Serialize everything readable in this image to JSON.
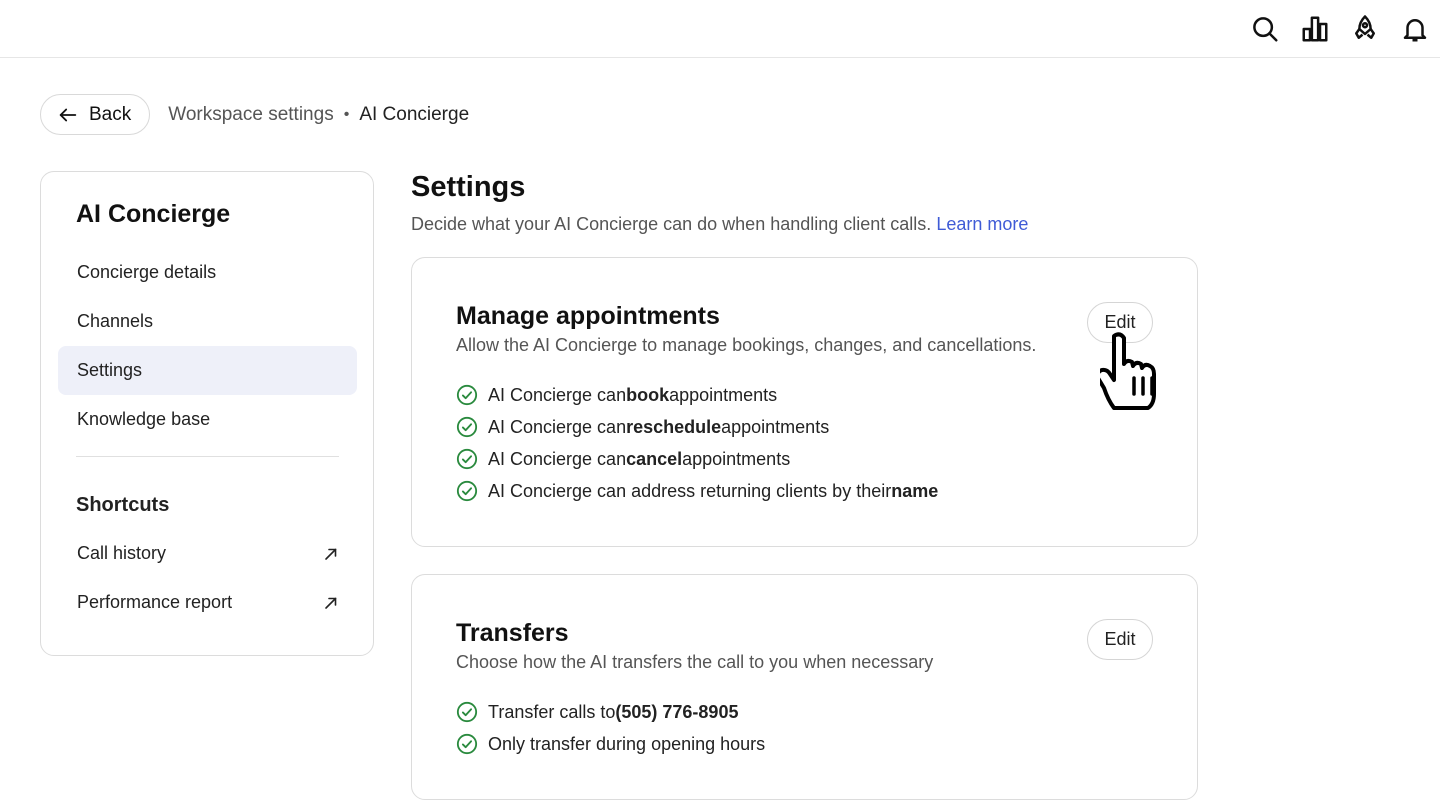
{
  "topbar": {
    "icons": [
      "search-icon",
      "bar-chart-icon",
      "rocket-icon",
      "bell-icon"
    ]
  },
  "breadcrumb": {
    "back_label": "Back",
    "parent": "Workspace settings",
    "separator": "•",
    "current": "AI Concierge"
  },
  "sidebar": {
    "title": "AI Concierge",
    "items": [
      {
        "label": "Concierge details",
        "active": false
      },
      {
        "label": "Channels",
        "active": false
      },
      {
        "label": "Settings",
        "active": true
      },
      {
        "label": "Knowledge base",
        "active": false
      }
    ],
    "shortcuts_title": "Shortcuts",
    "shortcuts": [
      {
        "label": "Call history",
        "icon": "external-link-icon"
      },
      {
        "label": "Performance report",
        "icon": "external-link-icon"
      }
    ]
  },
  "main": {
    "title": "Settings",
    "subtitle": "Decide what your AI Concierge can do when handling client calls.",
    "learn_more": "Learn more"
  },
  "manage": {
    "title": "Manage appointments",
    "description": "Allow the AI Concierge to manage bookings, changes, and cancellations.",
    "edit_label": "Edit",
    "rules": [
      {
        "pre": "AI Concierge can ",
        "bold": "book",
        "post": " appointments"
      },
      {
        "pre": "AI Concierge can ",
        "bold": "reschedule",
        "post": " appointments"
      },
      {
        "pre": "AI Concierge can ",
        "bold": "cancel",
        "post": " appointments"
      },
      {
        "pre": "AI Concierge can address returning clients by their ",
        "bold": "name",
        "post": ""
      }
    ]
  },
  "transfers": {
    "title": "Transfers",
    "description": "Choose how the AI transfers the call to you when necessary",
    "edit_label": "Edit",
    "rules": [
      {
        "pre": "Transfer calls to ",
        "bold": "(505) 776-8905",
        "post": ""
      },
      {
        "pre": "Only transfer during opening hours",
        "bold": "",
        "post": ""
      }
    ]
  },
  "colors": {
    "accent_link": "#3f5bd6",
    "check_green": "#2a8a3e",
    "active_bg": "#eef0f9"
  }
}
